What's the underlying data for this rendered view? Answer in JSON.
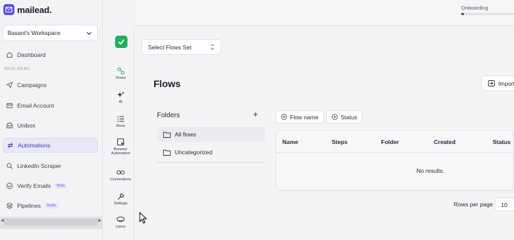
{
  "brand": {
    "name": "mailead.",
    "accent": "#5b53d6"
  },
  "workspace": {
    "name": "Basant's Workspace"
  },
  "sidebar": {
    "dashboard": "Dashboard",
    "section_label": "MAIN MENU",
    "items": [
      {
        "label": "Campaigns",
        "icon": "send-icon"
      },
      {
        "label": "Email Account",
        "icon": "mail-icon"
      },
      {
        "label": "Unibox",
        "icon": "inbox-icon"
      },
      {
        "label": "Automations",
        "icon": "arrows-icon",
        "active": true
      },
      {
        "label": "LinkedIn Scraper",
        "icon": "search-icon"
      },
      {
        "label": "Verify Emails",
        "icon": "check-circle-icon",
        "badge": "Beta"
      },
      {
        "label": "Pipelines",
        "icon": "layers-icon",
        "badge": "Invite"
      }
    ]
  },
  "rail": {
    "items": [
      {
        "label": "Flows",
        "icon": "flows-icon"
      },
      {
        "label": "AI",
        "icon": "sparkle-icon"
      },
      {
        "label": "Runs",
        "icon": "list-icon"
      },
      {
        "label": "Browser Automation",
        "icon": "browser-icon"
      },
      {
        "label": "Connections",
        "icon": "link-icon"
      },
      {
        "label": "Settings",
        "icon": "wrench-icon"
      },
      {
        "label": "Users",
        "icon": "users-icon"
      }
    ]
  },
  "topbar": {
    "onboarding_label": "Onboarding",
    "onboarding_progress": 0.05
  },
  "main": {
    "flows_set_placeholder": "Select Flows Set",
    "title": "Flows",
    "import_label": "Import",
    "folders": {
      "title": "Folders",
      "add": "+",
      "items": [
        "All flows",
        "Uncategorized"
      ]
    },
    "filters": {
      "flow_name": "Flow name",
      "status": "Status"
    },
    "table": {
      "columns": [
        "Name",
        "Steps",
        "Folder",
        "Created",
        "Status"
      ],
      "empty": "No results."
    },
    "pagination": {
      "rows_per_page_label": "Rows per page",
      "rows_per_page": "10"
    }
  }
}
